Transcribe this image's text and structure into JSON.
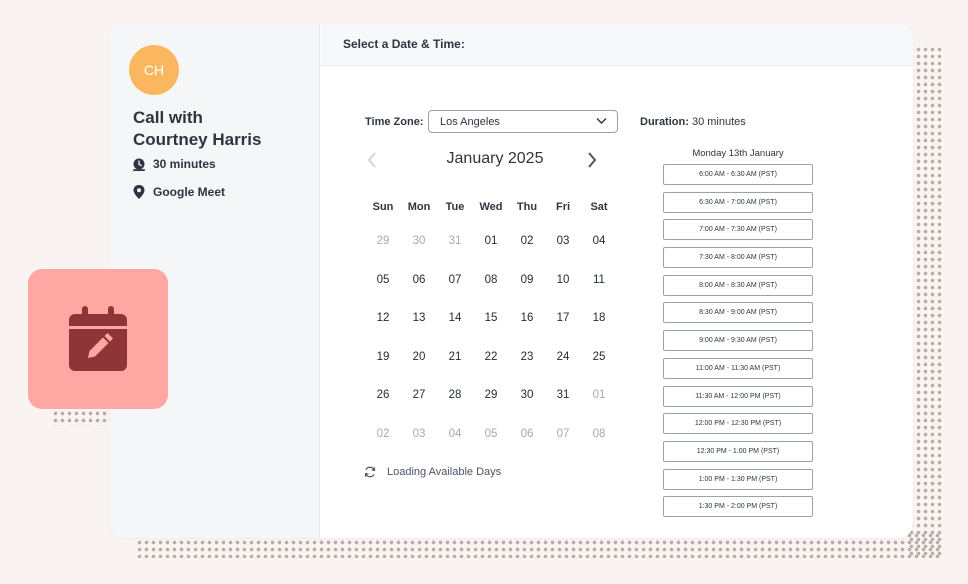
{
  "colors": {
    "background": "#f9f4f1",
    "avatar_bg": "#fbb760",
    "float_bg": "#ffa7a2",
    "float_icon": "#8f3538",
    "text": "#2d3540",
    "muted": "#a5abb3"
  },
  "sidebar": {
    "avatar_initials": "CH",
    "title_line1": "Call with",
    "title_line2": "Courtney Harris",
    "duration_icon": "clock-icon",
    "duration": "30 minutes",
    "location_icon": "map-pin-icon",
    "location": "Google Meet"
  },
  "header": {
    "title": "Select a Date & Time:"
  },
  "timezone": {
    "label": "Time Zone:",
    "value": "Los Angeles"
  },
  "calendar": {
    "month": "January 2025",
    "weekdays": [
      "Sun",
      "Mon",
      "Tue",
      "Wed",
      "Thu",
      "Fri",
      "Sat"
    ],
    "weeks": [
      [
        {
          "d": "29",
          "m": true
        },
        {
          "d": "30",
          "m": true
        },
        {
          "d": "31",
          "m": true
        },
        {
          "d": "01",
          "m": false
        },
        {
          "d": "02",
          "m": false
        },
        {
          "d": "03",
          "m": false
        },
        {
          "d": "04",
          "m": false
        }
      ],
      [
        {
          "d": "05",
          "m": false
        },
        {
          "d": "06",
          "m": false
        },
        {
          "d": "07",
          "m": false
        },
        {
          "d": "08",
          "m": false
        },
        {
          "d": "09",
          "m": false
        },
        {
          "d": "10",
          "m": false
        },
        {
          "d": "11",
          "m": false
        }
      ],
      [
        {
          "d": "12",
          "m": false
        },
        {
          "d": "13",
          "m": false
        },
        {
          "d": "14",
          "m": false
        },
        {
          "d": "15",
          "m": false
        },
        {
          "d": "16",
          "m": false
        },
        {
          "d": "17",
          "m": false
        },
        {
          "d": "18",
          "m": false
        }
      ],
      [
        {
          "d": "19",
          "m": false
        },
        {
          "d": "20",
          "m": false
        },
        {
          "d": "21",
          "m": false
        },
        {
          "d": "22",
          "m": false
        },
        {
          "d": "23",
          "m": false
        },
        {
          "d": "24",
          "m": false
        },
        {
          "d": "25",
          "m": false
        }
      ],
      [
        {
          "d": "26",
          "m": false
        },
        {
          "d": "27",
          "m": false
        },
        {
          "d": "28",
          "m": false
        },
        {
          "d": "29",
          "m": false
        },
        {
          "d": "30",
          "m": false
        },
        {
          "d": "31",
          "m": false
        },
        {
          "d": "01",
          "m": true
        }
      ],
      [
        {
          "d": "02",
          "m": true
        },
        {
          "d": "03",
          "m": true
        },
        {
          "d": "04",
          "m": true
        },
        {
          "d": "05",
          "m": true
        },
        {
          "d": "06",
          "m": true
        },
        {
          "d": "07",
          "m": true
        },
        {
          "d": "08",
          "m": true
        }
      ]
    ],
    "loading_text": "Loading Available Days"
  },
  "schedule": {
    "duration_label": "Duration:",
    "duration_value": "30 minutes",
    "date_heading": "Monday 13th January",
    "slots": [
      "6:00 AM - 6:30 AM (PST)",
      "6:30 AM - 7:00 AM (PST)",
      "7:00 AM - 7:30 AM (PST)",
      "7:30 AM - 8:00 AM (PST)",
      "8:00 AM - 8:30 AM (PST)",
      "8:30 AM - 9:00 AM (PST)",
      "9:00 AM - 9:30 AM (PST)",
      "11:00 AM - 11:30 AM (PST)",
      "11:30 AM - 12:00 PM (PST)",
      "12:00 PM - 12:30 PM (PST)",
      "12:30 PM - 1:00 PM (PST)",
      "1:00 PM - 1:30 PM (PST)",
      "1:30 PM - 2:00 PM (PST)"
    ]
  },
  "floating_icon": "calendar-edit-icon"
}
